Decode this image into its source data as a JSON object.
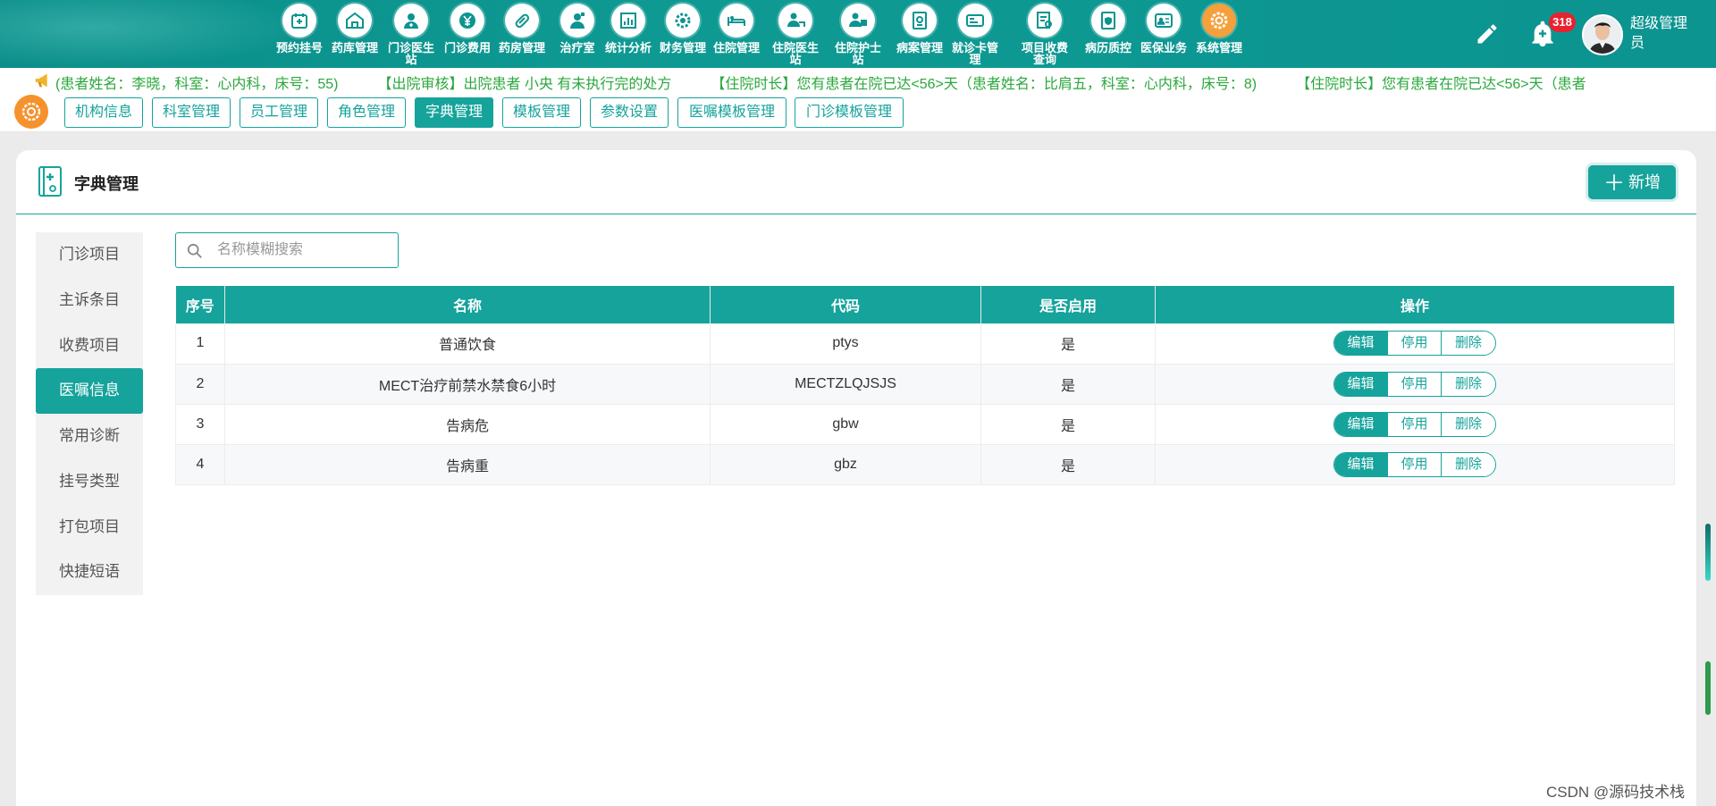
{
  "nav": {
    "items": [
      {
        "label": "预约挂号",
        "icon": "calendar-icon"
      },
      {
        "label": "药库管理",
        "icon": "warehouse-icon"
      },
      {
        "label": "门诊医生站",
        "icon": "doctor-icon"
      },
      {
        "label": "门诊费用",
        "icon": "yen-icon"
      },
      {
        "label": "药房管理",
        "icon": "pill-icon"
      },
      {
        "label": "治疗室",
        "icon": "nurse-icon"
      },
      {
        "label": "统计分析",
        "icon": "bar-chart-icon"
      },
      {
        "label": "财务管理",
        "icon": "finance-gear-icon"
      },
      {
        "label": "住院管理",
        "icon": "bed-icon"
      },
      {
        "label": "住院医生站",
        "icon": "doctor-bed-icon"
      },
      {
        "label": "住院护士站",
        "icon": "nurse-station-icon"
      },
      {
        "label": "病案管理",
        "icon": "record-icon"
      },
      {
        "label": "就诊卡管理",
        "icon": "card-icon"
      },
      {
        "label": "项目收费查询",
        "icon": "search-doc-icon"
      },
      {
        "label": "病历质控",
        "icon": "shield-doc-icon"
      },
      {
        "label": "医保业务",
        "icon": "insurance-icon"
      },
      {
        "label": "系统管理",
        "icon": "settings-gear-icon"
      }
    ],
    "active_index": 16,
    "notification_count": "318",
    "user_name": "超级管理员"
  },
  "marquee": {
    "messages": [
      "(患者姓名：李晓，科室：心内科，床号：55)",
      "【出院审核】出院患者 小央 有未执行完的处方",
      "【住院时长】您有患者在院已达<56>天（患者姓名：比肩五，科室：心内科，床号：8)",
      "【住院时长】您有患者在院已达<56>天（患者"
    ]
  },
  "subtabs": [
    {
      "label": "机构信息"
    },
    {
      "label": "科室管理"
    },
    {
      "label": "员工管理"
    },
    {
      "label": "角色管理"
    },
    {
      "label": "字典管理",
      "active": true
    },
    {
      "label": "模板管理"
    },
    {
      "label": "参数设置"
    },
    {
      "label": "医嘱模板管理"
    },
    {
      "label": "门诊模板管理"
    }
  ],
  "page": {
    "title": "字典管理",
    "add_label": "新增",
    "add_icon": "plus-icon"
  },
  "side_menu": {
    "items": [
      "门诊项目",
      "主诉条目",
      "收费项目",
      "医嘱信息",
      "常用诊断",
      "挂号类型",
      "打包项目",
      "快捷短语"
    ],
    "active_index": 3
  },
  "search": {
    "placeholder": "名称模糊搜索",
    "value": ""
  },
  "table": {
    "columns": [
      "序号",
      "名称",
      "代码",
      "是否启用",
      "操作"
    ],
    "actions": {
      "edit": "编辑",
      "disable": "停用",
      "delete": "删除"
    },
    "rows": [
      {
        "no": "1",
        "name": "普通饮食",
        "code": "ptys",
        "enabled": "是"
      },
      {
        "no": "2",
        "name": "MECT治疗前禁水禁食6小时",
        "code": "MECTZLQJSJS",
        "enabled": "是"
      },
      {
        "no": "3",
        "name": "告病危",
        "code": "gbw",
        "enabled": "是"
      },
      {
        "no": "4",
        "name": "告病重",
        "code": "gbz",
        "enabled": "是"
      }
    ]
  },
  "watermark": "CSDN @源码技术栈",
  "colors": {
    "primary": "#15a39b",
    "nav_bg": "#0c9490",
    "active_orange": "#f5922d",
    "marquee_text": "#2aa83c",
    "badge": "#e8222e"
  }
}
